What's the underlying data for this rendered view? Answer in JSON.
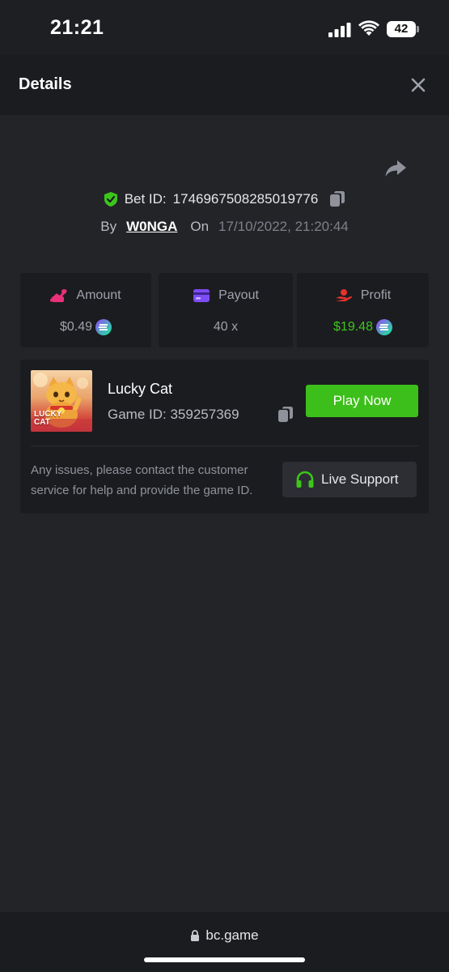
{
  "status_bar": {
    "time": "21:21",
    "battery": "42"
  },
  "header": {
    "title": "Details"
  },
  "bet": {
    "id_label": "Bet ID:",
    "id_value": "1746967508285019776",
    "by_label": "By",
    "user": "W0NGA",
    "on_label": "On",
    "date": "17/10/2022, 21:20:44"
  },
  "stats": [
    {
      "label": "Amount",
      "value": "$0.49",
      "color": "#9fa2aa"
    },
    {
      "label": "Payout",
      "value": "40 x",
      "color": "#9fa2aa"
    },
    {
      "label": "Profit",
      "value": "$19.48",
      "color": "#3dc61a"
    }
  ],
  "game": {
    "name": "Lucky Cat",
    "id_text": "Game ID: 359257369",
    "thumb_title_line1": "LUCKY",
    "thumb_title_line2": "CAT",
    "play_label": "Play Now"
  },
  "support": {
    "message": "Any issues, please contact the customer service for help and provide the game ID.",
    "button_label": "Live Support"
  },
  "browser": {
    "url": "bc.game"
  },
  "colors": {
    "accent_green": "#3dbf1b",
    "shield_green": "#3dc61a",
    "amount_pink": "#e9317a",
    "payout_purple": "#7d4cf4",
    "profit_red": "#e5322d"
  }
}
